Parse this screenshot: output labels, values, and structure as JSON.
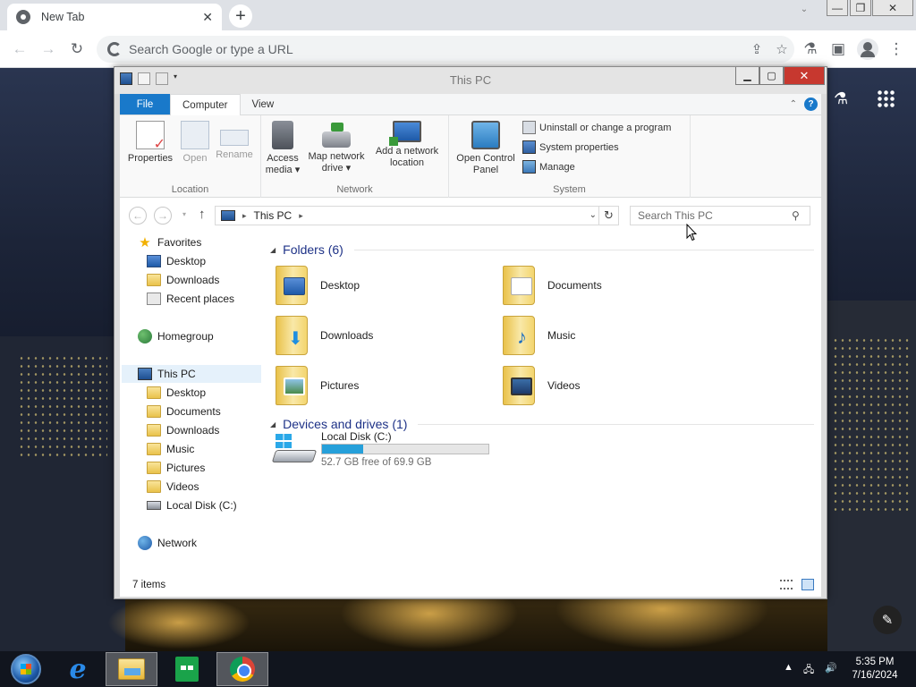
{
  "browser": {
    "tab_title": "New Tab",
    "tab_close": "✕",
    "new_tab": "+",
    "omnibox_placeholder": "Search Google or type a URL",
    "toolbar_icons": [
      "back-icon",
      "forward-icon",
      "reload-icon",
      "share-icon",
      "bookmark-star-icon",
      "extensions-icon",
      "side-panel-icon",
      "profile-icon",
      "menu-icon"
    ]
  },
  "explorer": {
    "title": "This PC",
    "ribbon_tabs": [
      "File",
      "Computer",
      "View"
    ],
    "ribbon": {
      "location": {
        "label": "Location",
        "buttons": [
          "Properties",
          "Open",
          "Rename"
        ]
      },
      "network": {
        "label": "Network",
        "access_media": [
          "Access",
          "media ▾"
        ],
        "map_drive": [
          "Map network",
          "drive ▾"
        ],
        "add_location": [
          "Add a network",
          "location"
        ]
      },
      "system": {
        "label": "System",
        "control_panel": [
          "Open Control",
          "Panel"
        ],
        "small": [
          "Uninstall or change a program",
          "System properties",
          "Manage"
        ]
      }
    },
    "address_path": "This PC",
    "search_placeholder": "Search This PC",
    "nav": {
      "favorites": "Favorites",
      "fav_items": [
        "Desktop",
        "Downloads",
        "Recent places"
      ],
      "homegroup": "Homegroup",
      "this_pc": "This PC",
      "pc_items": [
        "Desktop",
        "Documents",
        "Downloads",
        "Music",
        "Pictures",
        "Videos",
        "Local Disk (C:)"
      ],
      "network": "Network"
    },
    "folders_header": "Folders (6)",
    "folders": [
      "Desktop",
      "Documents",
      "Downloads",
      "Music",
      "Pictures",
      "Videos"
    ],
    "devices_header": "Devices and drives (1)",
    "drive": {
      "name": "Local Disk (C:)",
      "free_text": "52.7 GB free of 69.9 GB",
      "used_fraction": 0.246
    },
    "status": "7 items"
  },
  "taskbar": {
    "time": "5:35 PM",
    "date": "7/16/2024"
  },
  "colors": {
    "accent": "#1979ca",
    "close_red": "#c7382f",
    "drive_fill": "#26a0da"
  }
}
